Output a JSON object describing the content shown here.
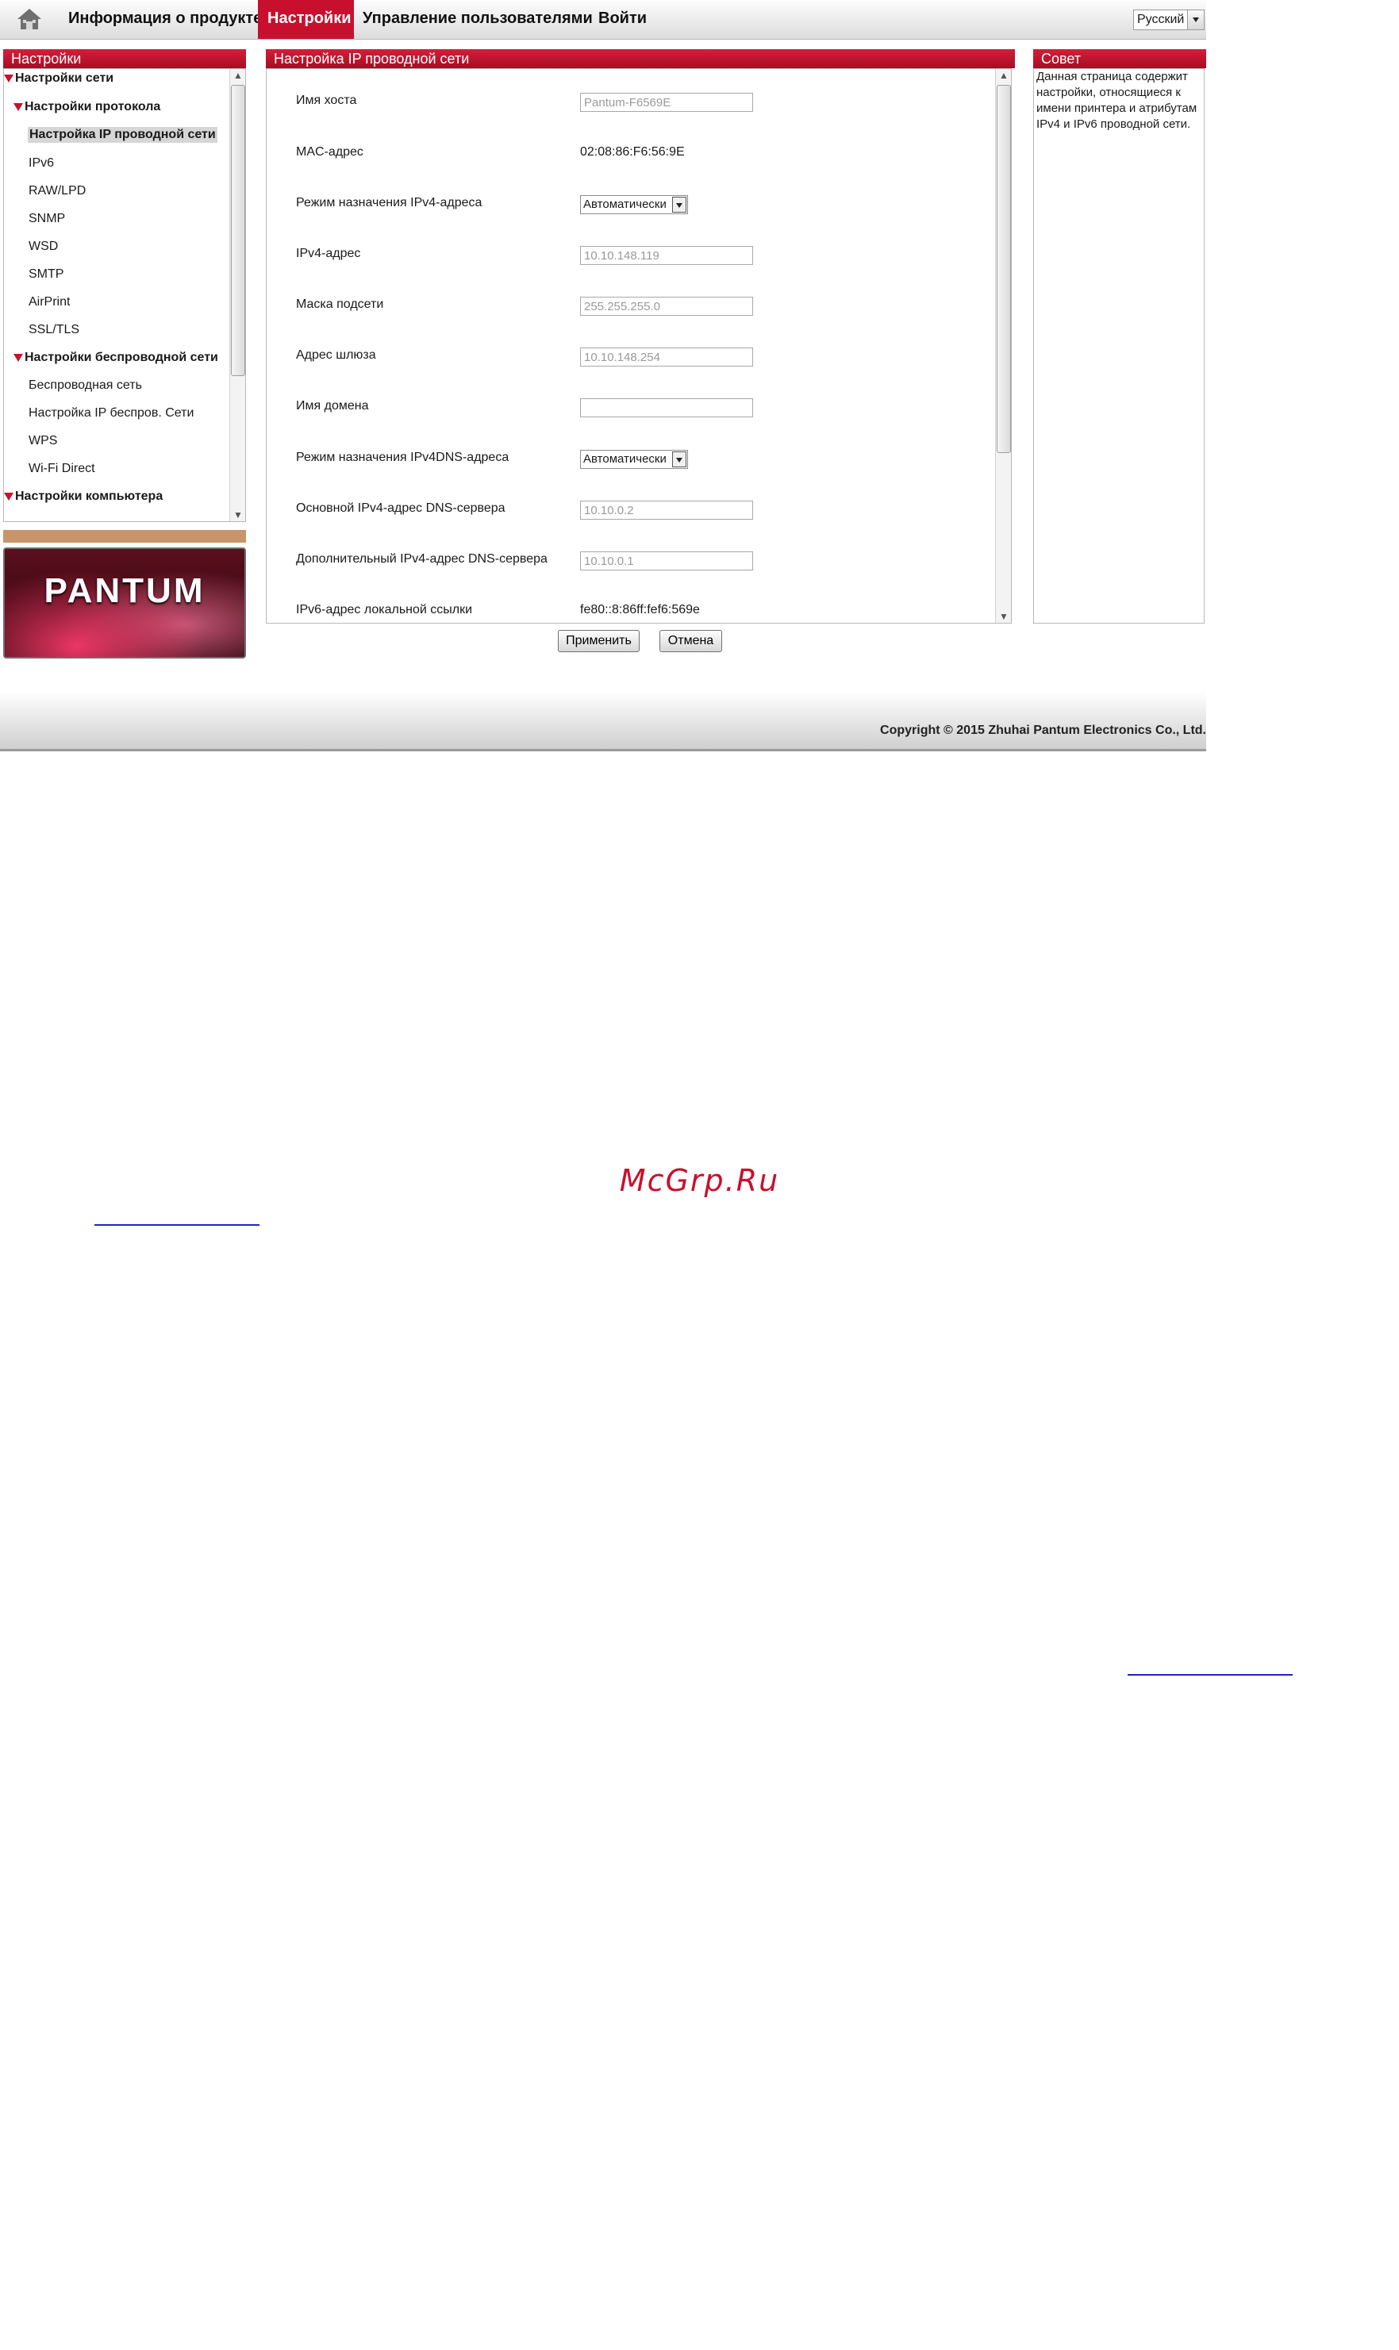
{
  "nav": {
    "items": [
      "Информация о продукте",
      "Настройки",
      "Управление пользователями",
      "Войти"
    ],
    "active_index": 1,
    "language": "Русский"
  },
  "sidebar": {
    "title": "Настройки",
    "items": [
      {
        "label": "Настройки сети",
        "level": 0,
        "expanded": true
      },
      {
        "label": "Настройки протокола",
        "level": 1,
        "expanded": true
      },
      {
        "label": "Настройка IP проводной сети",
        "level": 2,
        "selected": true
      },
      {
        "label": "IPv6",
        "level": 2
      },
      {
        "label": "RAW/LPD",
        "level": 2
      },
      {
        "label": "SNMP",
        "level": 2
      },
      {
        "label": "WSD",
        "level": 2
      },
      {
        "label": "SMTP",
        "level": 2
      },
      {
        "label": "AirPrint",
        "level": 2
      },
      {
        "label": "SSL/TLS",
        "level": 2
      },
      {
        "label": "Настройки беспроводной сети",
        "level": 1,
        "expanded": true
      },
      {
        "label": "Беспроводная сеть",
        "level": 2
      },
      {
        "label": "Настройка IP беспров. Сети",
        "level": 2
      },
      {
        "label": "WPS",
        "level": 2
      },
      {
        "label": "Wi-Fi Direct",
        "level": 2
      },
      {
        "label": "Настройки компьютера",
        "level": 0,
        "expanded": true
      }
    ]
  },
  "logo": {
    "text": "PANTUM"
  },
  "main": {
    "title": "Настройка IP проводной сети",
    "fields": [
      {
        "label": "Имя хоста",
        "type": "input",
        "value": "Pantum-F6569E"
      },
      {
        "label": "MAC-адрес",
        "type": "text",
        "value": "02:08:86:F6:56:9E"
      },
      {
        "label": "Режим назначения IPv4-адреса",
        "type": "select",
        "value": "Автоматически"
      },
      {
        "label": "IPv4-адрес",
        "type": "input",
        "value": "10.10.148.119"
      },
      {
        "label": "Маска подсети",
        "type": "input",
        "value": "255.255.255.0"
      },
      {
        "label": "Адрес шлюза",
        "type": "input",
        "value": "10.10.148.254"
      },
      {
        "label": "Имя домена",
        "type": "input",
        "value": ""
      },
      {
        "label": "Режим назначения IPv4DNS-адреса",
        "type": "select",
        "value": "Автоматически"
      },
      {
        "label": "Основной IPv4-адрес DNS-сервера",
        "type": "input",
        "value": "10.10.0.2"
      },
      {
        "label": "Дополнительный IPv4-адрес DNS-сервера",
        "type": "input",
        "value": "10.10.0.1"
      },
      {
        "label": "IPv6-адрес локальной ссылки",
        "type": "text",
        "value": "fe80::8:86ff:fef6:569e"
      }
    ]
  },
  "tip": {
    "title": "Совет",
    "text": "Данная страница содержит настройки, относящиеся к имени принтера и атрибутам IPv4 и IPv6 проводной сети."
  },
  "buttons": {
    "apply": "Применить",
    "cancel": "Отмена"
  },
  "footer": {
    "copyright": "Copyright © 2015 Zhuhai Pantum Electronics Co., Ltd."
  },
  "watermark": "McGrp.Ru",
  "colors": {
    "brand_red": "#c8102e",
    "tan": "#c8956a"
  }
}
